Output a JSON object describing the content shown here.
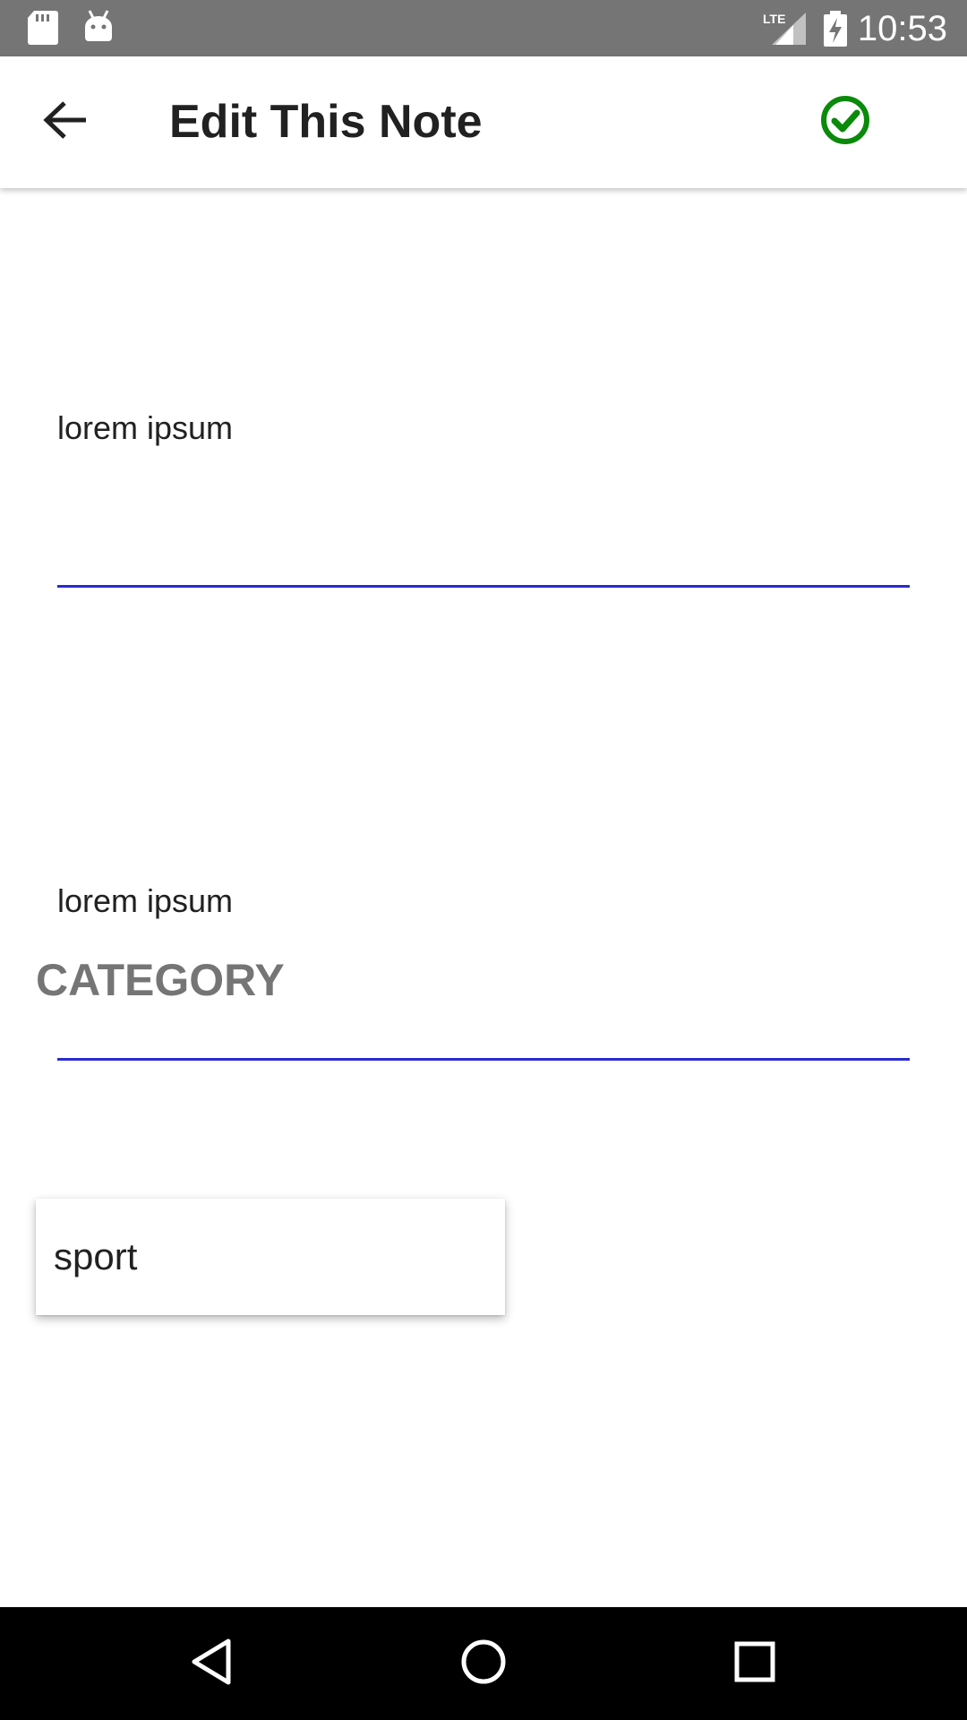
{
  "status_bar": {
    "time": "10:53",
    "icons": [
      "sd-card-icon",
      "android-icon",
      "lte-signal-icon",
      "battery-charging-icon"
    ],
    "lte_label": "LTE"
  },
  "app_bar": {
    "title": "Edit This Note",
    "back_icon": "arrow-back-icon",
    "save_icon": "check-circle-icon",
    "save_color": "#0a8a0a"
  },
  "form": {
    "title_field": {
      "value": "lorem ipsum"
    },
    "body_field": {
      "value": "lorem ipsum"
    },
    "underline_color": "#2a2ad0",
    "category": {
      "label": "CATEGORY",
      "selected": "sport"
    }
  },
  "nav_bar": {
    "buttons": [
      "back-triangle-icon",
      "home-circle-icon",
      "recents-square-icon"
    ]
  }
}
